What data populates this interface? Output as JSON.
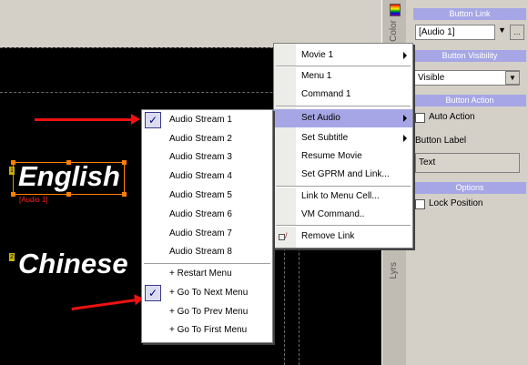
{
  "canvas": {
    "items": [
      {
        "number": "1",
        "text": "English",
        "tag": "[Audio 1]"
      },
      {
        "number": "2",
        "text": "Chinese"
      }
    ]
  },
  "side_tabs": {
    "color": "Color",
    "layers": "Lyrs"
  },
  "panel": {
    "button_link_header": "Button Link",
    "button_link_value": "[Audio 1]",
    "button_visibility_header": "Button Visibility",
    "visibility_value": "Visible",
    "button_action_header": "Button Action",
    "auto_action_label": "Auto Action",
    "button_label_heading": "Button Label",
    "button_label_value": "Text",
    "options_header": "Options",
    "lock_position_label": "Lock Position"
  },
  "context_menu": {
    "items": [
      {
        "label": "Movie 1",
        "submenu": true
      },
      {
        "label": "Menu 1"
      },
      {
        "label": "Command 1"
      },
      {
        "label": "Set Audio",
        "submenu": true,
        "highlighted": true
      },
      {
        "label": "Set Subtitle",
        "submenu": true
      },
      {
        "label": "Resume Movie"
      },
      {
        "label": "Set GPRM and Link..."
      },
      {
        "label": "Link to Menu Cell..."
      },
      {
        "label": "VM Command.."
      },
      {
        "label": "Remove Link",
        "icon": "unlink-icon"
      }
    ]
  },
  "audio_submenu": {
    "items": [
      {
        "label": "Audio Stream 1",
        "checked": true
      },
      {
        "label": "Audio Stream 2"
      },
      {
        "label": "Audio Stream 3"
      },
      {
        "label": "Audio Stream 4"
      },
      {
        "label": "Audio Stream 5"
      },
      {
        "label": "Audio Stream 6"
      },
      {
        "label": "Audio Stream 7"
      },
      {
        "label": "Audio Stream 8"
      },
      {
        "label": "+ Restart Menu"
      },
      {
        "label": "+ Go To Next Menu",
        "checked": true
      },
      {
        "label": "+ Go To Prev Menu"
      },
      {
        "label": "+ Go To First Menu"
      }
    ]
  },
  "colors": {
    "accent": "#a6a6e6",
    "selection": "#ff8000",
    "arrow": "#ee1111"
  }
}
